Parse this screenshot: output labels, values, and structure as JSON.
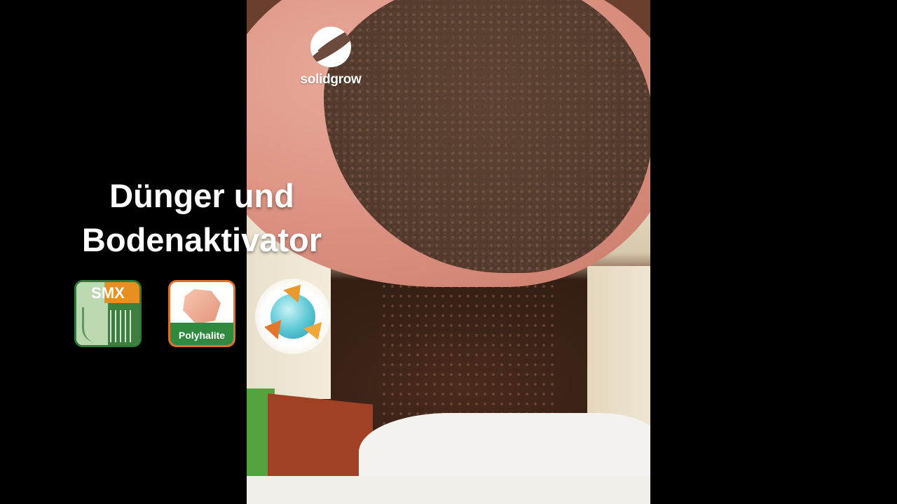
{
  "brand": {
    "name": "solidgrow"
  },
  "headline": {
    "line1": "Dünger und",
    "line2": "Bodenaktivator"
  },
  "badges": [
    {
      "label": "SMX",
      "icon": "smx-plant-roots-icon",
      "accent": "#e8901f",
      "frame": "#2f7a3a"
    },
    {
      "label": "Polyhalite",
      "icon": "polyhalite-crystal-icon",
      "accent": "#2f8a40",
      "frame": "#e0702b"
    },
    {
      "label": "",
      "icon": "recycle-globe-icon",
      "accent": "#e99a2c"
    }
  ],
  "colors": {
    "background": "#000000",
    "text": "#ffffff"
  }
}
